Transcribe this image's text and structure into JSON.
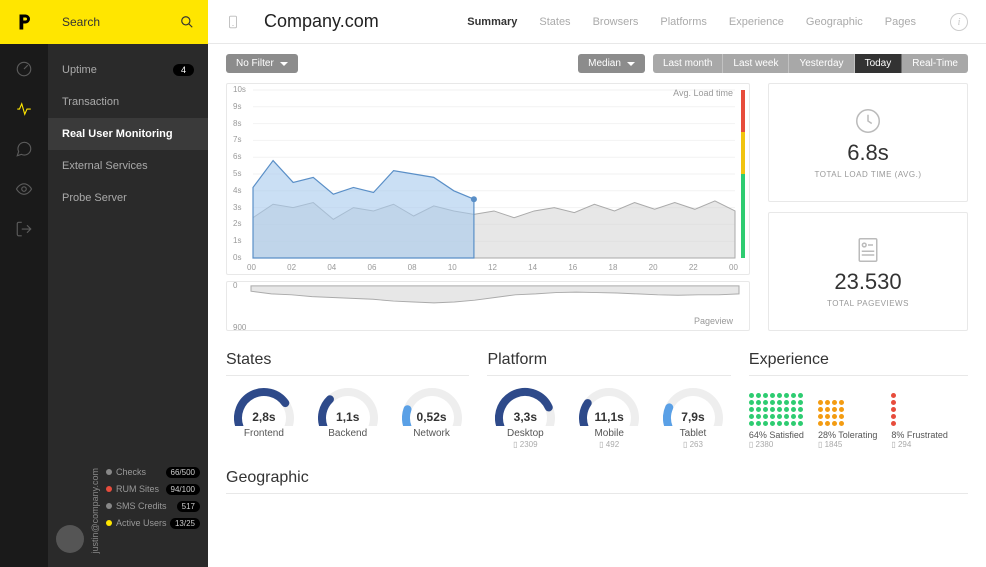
{
  "search_placeholder": "Search",
  "nav": [
    {
      "label": "Uptime",
      "badge": "4"
    },
    {
      "label": "Transaction"
    },
    {
      "label": "Real User Monitoring",
      "active": true
    },
    {
      "label": "External Services"
    },
    {
      "label": "Probe Server"
    }
  ],
  "user_email": "justin@company.com",
  "stats": [
    {
      "label": "Checks",
      "dot": "#888",
      "value": "66/500"
    },
    {
      "label": "RUM Sites",
      "dot": "#e74c3c",
      "value": "94/100"
    },
    {
      "label": "SMS Credits",
      "dot": "#888",
      "value": "517"
    },
    {
      "label": "Active Users",
      "dot": "#ffe600",
      "value": "13/25"
    }
  ],
  "site_name": "Company.com",
  "tabs": [
    "Summary",
    "States",
    "Browsers",
    "Platforms",
    "Experience",
    "Geographic",
    "Pages"
  ],
  "tab_active": 0,
  "filters": {
    "filter_label": "No Filter",
    "metric_label": "Median"
  },
  "time_ranges": [
    "Last month",
    "Last week",
    "Yesterday",
    "Today",
    "Real-Time"
  ],
  "time_active": 3,
  "kpi": {
    "load_time": {
      "value": "6.8s",
      "label": "TOTAL LOAD TIME (AVG.)"
    },
    "pageviews": {
      "value": "23.530",
      "label": "TOTAL PAGEVIEWS"
    }
  },
  "sections": {
    "states": {
      "title": "States",
      "items": [
        {
          "value": "2,8s",
          "label": "Frontend",
          "pct": 0.75,
          "color": "#2e4a8a"
        },
        {
          "value": "1,1s",
          "label": "Backend",
          "pct": 0.3,
          "color": "#2e4a8a"
        },
        {
          "value": "0,52s",
          "label": "Network",
          "pct": 0.18,
          "color": "#5aa0e6"
        }
      ]
    },
    "platform": {
      "title": "Platform",
      "items": [
        {
          "value": "3,3s",
          "label": "Desktop",
          "sub": "2309",
          "pct": 0.8,
          "color": "#2e4a8a"
        },
        {
          "value": "11,1s",
          "label": "Mobile",
          "sub": "492",
          "pct": 0.25,
          "color": "#2e4a8a"
        },
        {
          "value": "7,9s",
          "label": "Tablet",
          "sub": "263",
          "pct": 0.2,
          "color": "#5aa0e6"
        }
      ]
    },
    "experience": {
      "title": "Experience",
      "items": [
        {
          "label": "64% Satisfied",
          "sub": "2380",
          "color": "#2ecc71",
          "dots": 40,
          "cols": "lg"
        },
        {
          "label": "28% Tolerating",
          "sub": "1845",
          "color": "#f39c12",
          "dots": 16,
          "cols": "sm"
        },
        {
          "label": "8% Frustrated",
          "sub": "294",
          "color": "#e74c3c",
          "dots": 5,
          "cols": "xs"
        }
      ]
    },
    "geographic": {
      "title": "Geographic"
    }
  },
  "chart_data": {
    "main": {
      "type": "area",
      "title": "Avg. Load time",
      "ylabel": "s",
      "ylim": [
        0,
        10
      ],
      "yticks": [
        0,
        1,
        2,
        3,
        4,
        5,
        6,
        7,
        8,
        9,
        10
      ],
      "x": [
        "00",
        "02",
        "04",
        "06",
        "08",
        "10",
        "12",
        "14",
        "16",
        "18",
        "20",
        "22",
        "00"
      ],
      "series": [
        {
          "name": "current",
          "color": "#a7c9ec",
          "values": [
            4.2,
            5.8,
            4.5,
            4.8,
            3.8,
            4.2,
            3.9,
            5.2,
            5.0,
            4.8,
            4.0,
            3.5,
            null,
            null,
            null,
            null,
            null,
            null,
            null,
            null,
            null,
            null,
            null,
            null,
            null
          ]
        },
        {
          "name": "previous",
          "color": "#cfcfcf",
          "values": [
            2.4,
            3.2,
            3.0,
            3.3,
            2.3,
            3.0,
            2.8,
            3.2,
            2.5,
            3.1,
            2.8,
            2.6,
            2.8,
            2.4,
            2.8,
            3.0,
            2.7,
            3.2,
            2.8,
            3.3,
            2.9,
            3.3,
            2.9,
            3.4,
            2.8
          ]
        }
      ]
    },
    "mini": {
      "type": "area",
      "title": "Pageview",
      "ylim": [
        0,
        900
      ],
      "yticks": [
        0,
        900
      ],
      "values": [
        120,
        180,
        200,
        240,
        260,
        280,
        300,
        340,
        360,
        380,
        360,
        320,
        260,
        200,
        180,
        150,
        140,
        150,
        160,
        180,
        200,
        210,
        200,
        200,
        180
      ]
    }
  }
}
